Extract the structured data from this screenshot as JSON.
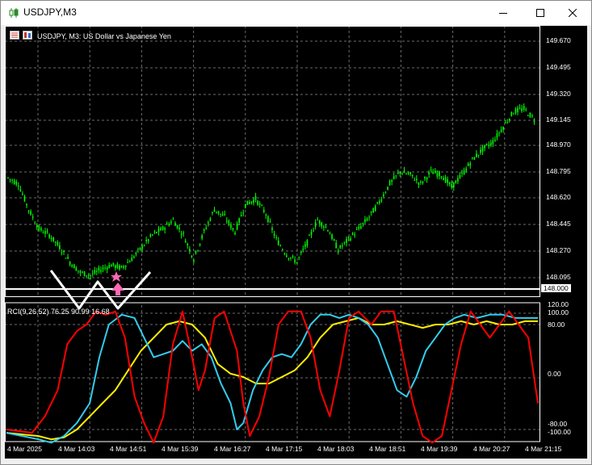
{
  "window": {
    "title": "USDJPY,M3",
    "icons": {
      "app": "chart-candles-icon",
      "minimize": "minimize-icon",
      "maximize": "maximize-icon",
      "close": "close-icon"
    }
  },
  "chart": {
    "info_text": "USDJPY, M3:  US Dollar vs Japanese Yen",
    "colors": {
      "background": "#000000",
      "grid": "#6b6b6b",
      "candles": "#00ff00",
      "hline": "#ffffff",
      "rci_fast": "#ff0000",
      "rci_mid": "#33ccee",
      "rci_slow": "#ffee00",
      "arrow": "#ff69b4",
      "w_shape": "#ffffff"
    },
    "price_scale": [
      "149.670",
      "149.495",
      "149.320",
      "149.145",
      "148.970",
      "148.795",
      "148.620",
      "148.445",
      "148.270",
      "148.095"
    ],
    "hline_value": "148.000",
    "indicator_label": "RCI(9,26,52) 76.25 90.99 16.68",
    "indicator_scale": [
      "120.00",
      "100.00",
      "80.00",
      "0.00",
      "-80.00",
      "-100.00"
    ],
    "time_labels": [
      "4 Mar 2025",
      "4 Mar 14:03",
      "4 Mar 14:51",
      "4 Mar 15:39",
      "4 Mar 16:27",
      "4 Mar 17:15",
      "4 Mar 18:03",
      "4 Mar 18:51",
      "4 Mar 19:39",
      "4 Mar 20:27",
      "4 Mar 21:15"
    ]
  },
  "chart_data": {
    "type": "line",
    "title": "USDJPY, M3:  US Dollar vs Japanese Yen",
    "price_anchors": [
      [
        0,
        148.76
      ],
      [
        5,
        148.72
      ],
      [
        10,
        148.55
      ],
      [
        15,
        148.42
      ],
      [
        20,
        148.38
      ],
      [
        25,
        148.3
      ],
      [
        30,
        148.2
      ],
      [
        35,
        148.13
      ],
      [
        40,
        148.11
      ],
      [
        45,
        148.15
      ],
      [
        50,
        148.18
      ],
      [
        55,
        148.16
      ],
      [
        60,
        148.22
      ],
      [
        65,
        148.3
      ],
      [
        70,
        148.38
      ],
      [
        75,
        148.42
      ],
      [
        80,
        148.48
      ],
      [
        85,
        148.38
      ],
      [
        90,
        148.22
      ],
      [
        95,
        148.4
      ],
      [
        100,
        148.55
      ],
      [
        105,
        148.5
      ],
      [
        110,
        148.4
      ],
      [
        115,
        148.58
      ],
      [
        120,
        148.62
      ],
      [
        125,
        148.52
      ],
      [
        130,
        148.35
      ],
      [
        135,
        148.25
      ],
      [
        140,
        148.2
      ],
      [
        145,
        148.33
      ],
      [
        150,
        148.48
      ],
      [
        155,
        148.42
      ],
      [
        160,
        148.28
      ],
      [
        165,
        148.35
      ],
      [
        170,
        148.42
      ],
      [
        175,
        148.5
      ],
      [
        180,
        148.6
      ],
      [
        185,
        148.72
      ],
      [
        190,
        148.8
      ],
      [
        195,
        148.78
      ],
      [
        200,
        148.72
      ],
      [
        205,
        148.8
      ],
      [
        210,
        148.78
      ],
      [
        215,
        148.7
      ],
      [
        220,
        148.78
      ],
      [
        225,
        148.88
      ],
      [
        230,
        148.95
      ],
      [
        235,
        149.0
      ],
      [
        240,
        149.1
      ],
      [
        245,
        149.2
      ],
      [
        250,
        149.22
      ],
      [
        255,
        149.15
      ]
    ],
    "rci_fast": [
      [
        0,
        -80
      ],
      [
        8,
        -85
      ],
      [
        12,
        -60
      ],
      [
        16,
        -20
      ],
      [
        19,
        50
      ],
      [
        22,
        70
      ],
      [
        25,
        80
      ],
      [
        28,
        100
      ],
      [
        31,
        95
      ],
      [
        34,
        100
      ],
      [
        37,
        60
      ],
      [
        40,
        -30
      ],
      [
        43,
        -70
      ],
      [
        46,
        -100
      ],
      [
        49,
        -60
      ],
      [
        52,
        50
      ],
      [
        55,
        100
      ],
      [
        58,
        30
      ],
      [
        60,
        -20
      ],
      [
        62,
        10
      ],
      [
        65,
        90
      ],
      [
        68,
        100
      ],
      [
        72,
        40
      ],
      [
        74,
        -40
      ],
      [
        76,
        -90
      ],
      [
        79,
        -60
      ],
      [
        82,
        0
      ],
      [
        85,
        80
      ],
      [
        88,
        100
      ],
      [
        92,
        100
      ],
      [
        95,
        60
      ],
      [
        98,
        -20
      ],
      [
        101,
        -60
      ],
      [
        104,
        10
      ],
      [
        107,
        90
      ],
      [
        110,
        100
      ],
      [
        114,
        80
      ],
      [
        117,
        100
      ],
      [
        121,
        100
      ],
      [
        124,
        30
      ],
      [
        127,
        -40
      ],
      [
        130,
        -90
      ],
      [
        133,
        -100
      ],
      [
        136,
        -90
      ],
      [
        139,
        -20
      ],
      [
        142,
        50
      ],
      [
        145,
        100
      ],
      [
        148,
        80
      ],
      [
        151,
        60
      ],
      [
        154,
        80
      ],
      [
        157,
        100
      ],
      [
        160,
        80
      ],
      [
        163,
        60
      ],
      [
        166,
        -40
      ]
    ],
    "rci_mid": [
      [
        0,
        -85
      ],
      [
        10,
        -95
      ],
      [
        14,
        -100
      ],
      [
        18,
        -90
      ],
      [
        22,
        -70
      ],
      [
        26,
        -40
      ],
      [
        29,
        30
      ],
      [
        32,
        80
      ],
      [
        36,
        95
      ],
      [
        40,
        90
      ],
      [
        43,
        60
      ],
      [
        46,
        30
      ],
      [
        49,
        35
      ],
      [
        52,
        40
      ],
      [
        55,
        55
      ],
      [
        58,
        40
      ],
      [
        61,
        50
      ],
      [
        64,
        30
      ],
      [
        67,
        -10
      ],
      [
        70,
        -40
      ],
      [
        72,
        -80
      ],
      [
        74,
        -70
      ],
      [
        77,
        -20
      ],
      [
        80,
        10
      ],
      [
        83,
        30
      ],
      [
        86,
        35
      ],
      [
        89,
        30
      ],
      [
        92,
        50
      ],
      [
        95,
        80
      ],
      [
        98,
        95
      ],
      [
        101,
        95
      ],
      [
        104,
        90
      ],
      [
        107,
        95
      ],
      [
        110,
        90
      ],
      [
        113,
        80
      ],
      [
        116,
        60
      ],
      [
        119,
        20
      ],
      [
        122,
        -20
      ],
      [
        125,
        -30
      ],
      [
        128,
        0
      ],
      [
        131,
        40
      ],
      [
        134,
        60
      ],
      [
        137,
        80
      ],
      [
        140,
        90
      ],
      [
        143,
        95
      ],
      [
        147,
        90
      ],
      [
        151,
        95
      ],
      [
        155,
        95
      ],
      [
        159,
        90
      ],
      [
        166,
        90
      ]
    ],
    "rci_slow": [
      [
        0,
        -85
      ],
      [
        10,
        -90
      ],
      [
        14,
        -95
      ],
      [
        18,
        -92
      ],
      [
        22,
        -80
      ],
      [
        26,
        -60
      ],
      [
        30,
        -40
      ],
      [
        34,
        -20
      ],
      [
        38,
        10
      ],
      [
        42,
        40
      ],
      [
        46,
        60
      ],
      [
        50,
        80
      ],
      [
        54,
        85
      ],
      [
        58,
        80
      ],
      [
        62,
        60
      ],
      [
        66,
        20
      ],
      [
        70,
        5
      ],
      [
        74,
        0
      ],
      [
        78,
        -10
      ],
      [
        82,
        -10
      ],
      [
        86,
        0
      ],
      [
        90,
        10
      ],
      [
        94,
        30
      ],
      [
        98,
        60
      ],
      [
        102,
        80
      ],
      [
        106,
        85
      ],
      [
        110,
        90
      ],
      [
        114,
        80
      ],
      [
        118,
        80
      ],
      [
        122,
        85
      ],
      [
        126,
        80
      ],
      [
        130,
        75
      ],
      [
        134,
        80
      ],
      [
        138,
        80
      ],
      [
        142,
        85
      ],
      [
        146,
        80
      ],
      [
        150,
        85
      ],
      [
        154,
        80
      ],
      [
        158,
        80
      ],
      [
        162,
        85
      ],
      [
        166,
        85
      ]
    ],
    "ylim_price": [
      148.0,
      149.72
    ],
    "ylim_indicator": [
      -100,
      120
    ],
    "grid": true
  }
}
